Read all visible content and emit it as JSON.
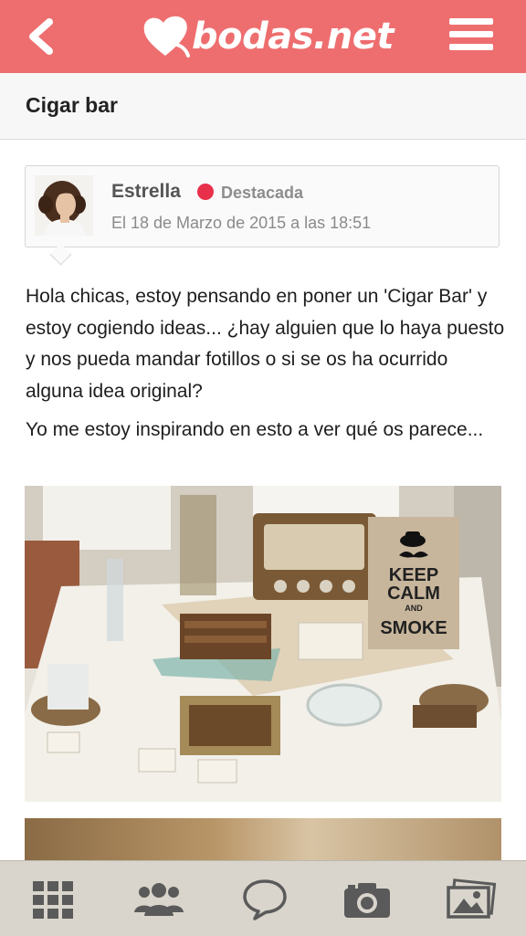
{
  "header": {
    "logo_text": "bodas.net",
    "back_icon": "chevron-left-icon",
    "menu_icon": "hamburger-menu-icon",
    "background_color": "#ee6e6f"
  },
  "page": {
    "title": "Cigar bar"
  },
  "post": {
    "author": "Estrella",
    "status_color": "#e9304b",
    "badge": "Destacada",
    "date": "El 18 de Marzo de 2015 a las 18:51",
    "paragraphs": [
      "Hola chicas, estoy pensando en poner un 'Cigar Bar' y estoy cogiendo ideas... ¿hay alguien que lo haya puesto y nos pueda mandar fotillos o si se os ha ocurrido alguna idea original?",
      "Yo me estoy inspirando en esto a ver qué os parece..."
    ],
    "image": {
      "sign_lines": [
        "KEEP",
        "CALM",
        "AND",
        "SMOKE"
      ]
    }
  },
  "tabbar": {
    "icons": [
      "grid-icon",
      "community-icon",
      "chat-bubble-icon",
      "camera-icon",
      "photos-icon"
    ]
  }
}
